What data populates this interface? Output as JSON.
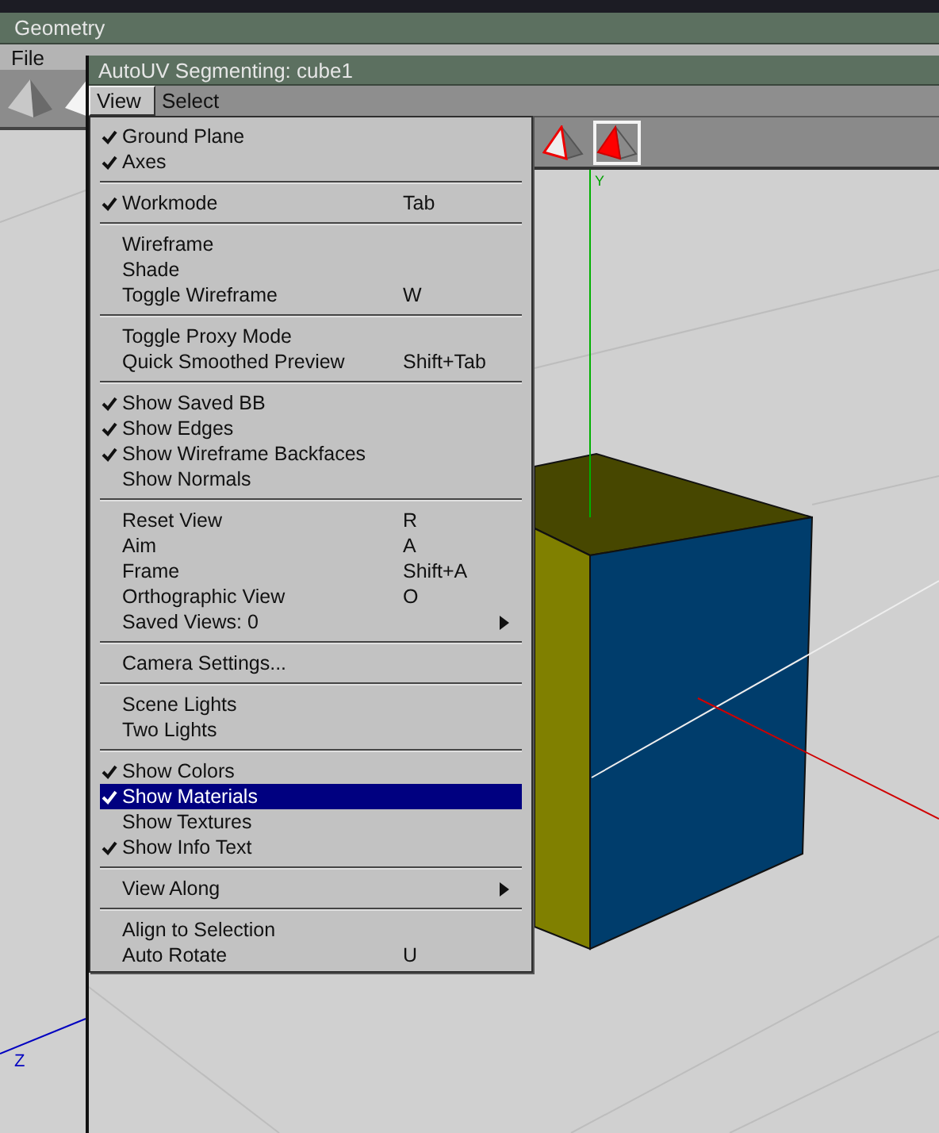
{
  "main_window": {
    "title": "Geometry",
    "menu": [
      "File"
    ],
    "viewport": {
      "axis_label": "Z"
    }
  },
  "overlay_window": {
    "title": "AutoUV Segmenting: cube1",
    "menu": [
      {
        "label": "View",
        "selected": true
      },
      {
        "label": "Select",
        "selected": false
      }
    ],
    "toolbar": [
      {
        "kind": "wire",
        "selected": false
      },
      {
        "kind": "solid",
        "selected": true
      }
    ],
    "viewport": {
      "axis_label": "Y"
    }
  },
  "view_menu": {
    "sections": [
      {
        "items": [
          {
            "label": "Ground Plane",
            "checked": true,
            "selected": false,
            "submenu": false
          },
          {
            "label": "Axes",
            "checked": true,
            "selected": false,
            "submenu": false
          }
        ]
      },
      {
        "items": [
          {
            "label": "Workmode",
            "shortcut": "Tab",
            "checked": true,
            "selected": false,
            "submenu": false
          }
        ]
      },
      {
        "items": [
          {
            "label": "Wireframe",
            "checked": false,
            "selected": false,
            "submenu": false
          },
          {
            "label": "Shade",
            "checked": false,
            "selected": false,
            "submenu": false
          },
          {
            "label": "Toggle Wireframe",
            "shortcut": "W",
            "checked": false,
            "selected": false,
            "submenu": false
          }
        ]
      },
      {
        "items": [
          {
            "label": "Toggle Proxy Mode",
            "checked": false,
            "selected": false,
            "submenu": false
          },
          {
            "label": "Quick Smoothed Preview",
            "shortcut": "Shift+Tab",
            "checked": false,
            "selected": false,
            "submenu": false
          }
        ]
      },
      {
        "items": [
          {
            "label": "Show Saved BB",
            "checked": true,
            "selected": false,
            "submenu": false
          },
          {
            "label": "Show Edges",
            "checked": true,
            "selected": false,
            "submenu": false
          },
          {
            "label": "Show Wireframe Backfaces",
            "checked": true,
            "selected": false,
            "submenu": false
          },
          {
            "label": "Show Normals",
            "checked": false,
            "selected": false,
            "submenu": false
          }
        ]
      },
      {
        "items": [
          {
            "label": "Reset View",
            "shortcut": "R",
            "checked": false,
            "selected": false,
            "submenu": false
          },
          {
            "label": "Aim",
            "shortcut": "A",
            "checked": false,
            "selected": false,
            "submenu": false
          },
          {
            "label": "Frame",
            "shortcut": "Shift+A",
            "checked": false,
            "selected": false,
            "submenu": false
          },
          {
            "label": "Orthographic View",
            "shortcut": "O",
            "checked": false,
            "selected": false,
            "submenu": false
          },
          {
            "label": "Saved Views: 0",
            "checked": false,
            "selected": false,
            "submenu": true
          }
        ]
      },
      {
        "items": [
          {
            "label": "Camera Settings...",
            "checked": false,
            "selected": false,
            "submenu": false
          }
        ]
      },
      {
        "items": [
          {
            "label": "Scene Lights",
            "checked": false,
            "selected": false,
            "submenu": false
          },
          {
            "label": "Two Lights",
            "checked": false,
            "selected": false,
            "submenu": false
          }
        ]
      },
      {
        "items": [
          {
            "label": "Show Colors",
            "checked": true,
            "selected": false,
            "submenu": false
          },
          {
            "label": "Show Materials",
            "checked": true,
            "selected": true,
            "submenu": false
          },
          {
            "label": "Show Textures",
            "checked": false,
            "selected": false,
            "submenu": false
          },
          {
            "label": "Show Info Text",
            "checked": true,
            "selected": false,
            "submenu": false
          }
        ]
      },
      {
        "items": [
          {
            "label": "View Along",
            "checked": false,
            "selected": false,
            "submenu": true
          }
        ]
      },
      {
        "items": [
          {
            "label": "Align to Selection",
            "checked": false,
            "selected": false,
            "submenu": false
          },
          {
            "label": "Auto Rotate",
            "shortcut": "U",
            "checked": false,
            "selected": false,
            "submenu": false
          }
        ]
      }
    ]
  }
}
